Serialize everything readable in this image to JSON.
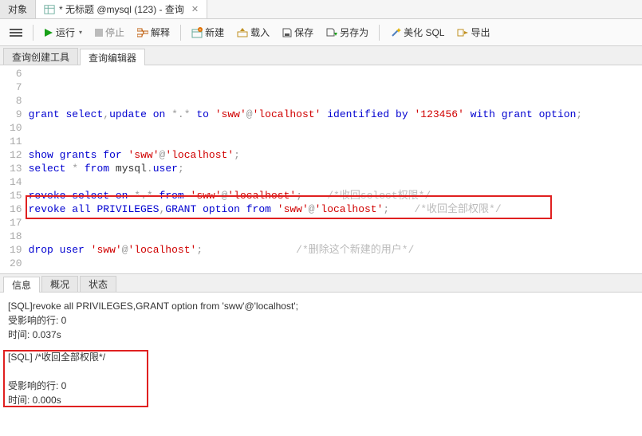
{
  "top_tabs": {
    "objects": "对象",
    "query": "* 无标题 @mysql (123) - 查询"
  },
  "toolbar": {
    "run": "运行",
    "stop": "停止",
    "explain": "解释",
    "new": "新建",
    "load": "载入",
    "save": "保存",
    "save_as": "另存为",
    "beautify": "美化 SQL",
    "export": "导出"
  },
  "sub_tabs": {
    "builder": "查询创建工具",
    "editor": "查询编辑器"
  },
  "code": {
    "line_start": 6,
    "line_end": 20,
    "l9_a": "grant",
    "l9_b": "select",
    "l9_c": "update",
    "l9_d": "on",
    "l9_e": "to",
    "l9_s1": "'sww'",
    "l9_s2": "'localhost'",
    "l9_f": "identified",
    "l9_g": "by",
    "l9_s3": "'123456'",
    "l9_h": "with",
    "l9_i": "grant",
    "l9_j": "option",
    "l12_a": "show",
    "l12_b": "grants",
    "l12_c": "for",
    "l12_s1": "'sww'",
    "l12_s2": "'localhost'",
    "l13_a": "select",
    "l13_b": "from",
    "l13_c": "mysql",
    "l13_d": "user",
    "l15_a": "revoke",
    "l15_b": "select",
    "l15_c": "on",
    "l15_d": "from",
    "l15_s1": "'sww'",
    "l15_s2": "'localhost'",
    "l15_cmt": "/*收回select权限*/",
    "l16_a": "revoke",
    "l16_b": "all",
    "l16_c": "PRIVILEGES",
    "l16_d": "GRANT",
    "l16_e": "option",
    "l16_f": "from",
    "l16_s1": "'sww'",
    "l16_s2": "'localhost'",
    "l16_cmt": "/*收回全部权限*/",
    "l19_a": "drop",
    "l19_b": "user",
    "l19_s1": "'sww'",
    "l19_s2": "'localhost'",
    "l19_cmt": "/*删除这个新建的用户*/"
  },
  "bot_tabs": {
    "info": "信息",
    "profile": "概况",
    "status": "状态"
  },
  "output": {
    "block1_line1": "[SQL]revoke all PRIVILEGES,GRANT option from 'sww'@'localhost';",
    "block1_line2": "受影响的行: 0",
    "block1_line3": "时间: 0.037s",
    "block2_line1": "[SQL]   /*收回全部权限*/",
    "block2_line2": "受影响的行: 0",
    "block2_line3": "时间: 0.000s"
  }
}
